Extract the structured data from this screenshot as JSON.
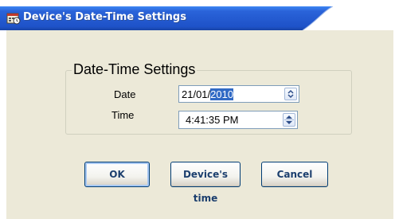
{
  "window": {
    "title": "Device's Date-Time Settings"
  },
  "group": {
    "title": "Date-Time Settings"
  },
  "date": {
    "label": "Date",
    "value_prefix": "21/01/",
    "value_selected": "2010"
  },
  "time": {
    "label": "Time",
    "value": "4:41:35 PM"
  },
  "buttons": {
    "ok": "OK",
    "device_time": "Device's time",
    "cancel": "Cancel"
  },
  "colors": {
    "titlebar": "#2a63d9",
    "accent": "#316ac5",
    "dialog_bg": "#ece9d8",
    "button_text": "#1c3f6e"
  },
  "icons": {
    "title_icon": "calendar-clock-icon",
    "date_spinner": "up-down-spinner-icon",
    "time_spinner": "up-down-spinner-icon"
  }
}
